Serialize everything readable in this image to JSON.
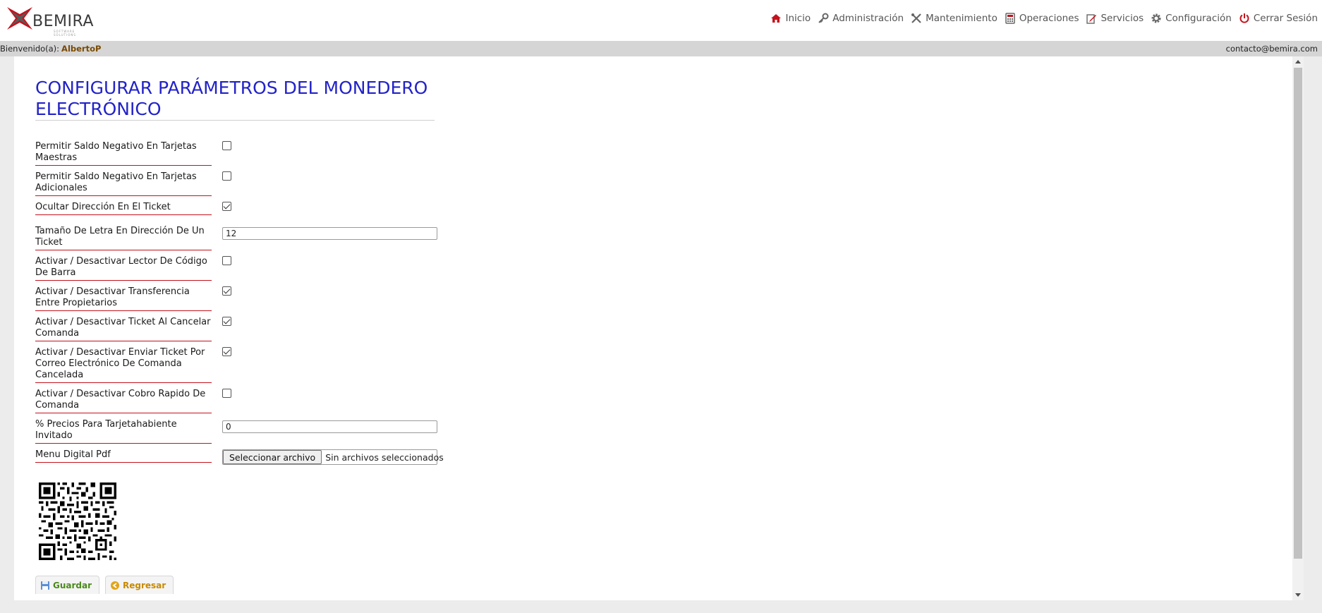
{
  "brand": {
    "name": "BEMIRA",
    "tagline": "SOFTWARE SOLUTIONS",
    "accent": "#c4121c"
  },
  "nav": [
    {
      "label": "Inicio",
      "icon": "home-icon"
    },
    {
      "label": "Administración",
      "icon": "key-icon"
    },
    {
      "label": "Mantenimiento",
      "icon": "tools-icon"
    },
    {
      "label": "Operaciones",
      "icon": "calculator-icon"
    },
    {
      "label": "Servicios",
      "icon": "edit-icon"
    },
    {
      "label": "Configuración",
      "icon": "gear-icon"
    },
    {
      "label": "Cerrar Sesión",
      "icon": "power-icon"
    }
  ],
  "welcome": {
    "prefix": "Bienvenido(a):",
    "user": "AlbertoP",
    "email": "contacto@bemira.com"
  },
  "page": {
    "title": "Configurar Parámetros del Monedero Electrónico"
  },
  "fields": [
    {
      "label": "Permitir Saldo Negativo En Tarjetas Maestras",
      "type": "checkbox",
      "checked": false
    },
    {
      "label": "Permitir Saldo Negativo En Tarjetas Adicionales",
      "type": "checkbox",
      "checked": false
    },
    {
      "label": "Ocultar Dirección En El Ticket",
      "type": "checkbox",
      "checked": true
    },
    {
      "label": "Tamaño De Letra En Dirección De Un Ticket",
      "type": "text",
      "value": "12"
    },
    {
      "label": "Activar / Desactivar Lector De Código De Barra",
      "type": "checkbox",
      "checked": false
    },
    {
      "label": "Activar / Desactivar Transferencia Entre Propietarios",
      "type": "checkbox",
      "checked": true
    },
    {
      "label": "Activar / Desactivar Ticket Al Cancelar Comanda",
      "type": "checkbox",
      "checked": true
    },
    {
      "label": "Activar / Desactivar Enviar Ticket Por Correo Electrónico De Comanda Cancelada",
      "type": "checkbox",
      "checked": true
    },
    {
      "label": "Activar / Desactivar Cobro Rapido De Comanda",
      "type": "checkbox",
      "checked": false
    },
    {
      "label": "% Precios Para Tarjetahabiente Invitado",
      "type": "text",
      "value": "0"
    },
    {
      "label": "Menu Digital Pdf",
      "type": "file",
      "button": "Seleccionar archivo",
      "status": "Sin archivos seleccionados"
    }
  ],
  "actions": {
    "save": "Guardar",
    "back": "Regresar"
  }
}
